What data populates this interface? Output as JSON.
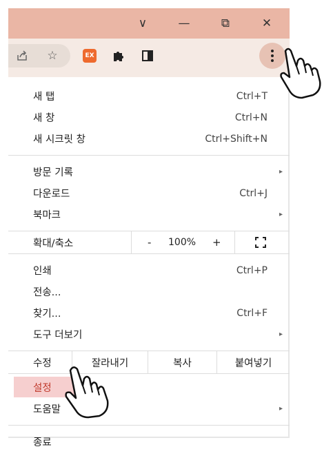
{
  "window": {
    "dropdown_glyph": "∨",
    "minimize_glyph": "—",
    "restore_glyph": "⧉",
    "close_glyph": "✕"
  },
  "toolbar": {
    "extension_badge": "EX",
    "icons": [
      "share-icon",
      "star-icon",
      "extension-ex-icon",
      "puzzle-icon",
      "side-panel-icon",
      "more-menu-icon"
    ]
  },
  "menu": {
    "group1": [
      {
        "label": "새 탭",
        "shortcut": "Ctrl+T"
      },
      {
        "label": "새 창",
        "shortcut": "Ctrl+N"
      },
      {
        "label": "새 시크릿 창",
        "shortcut": "Ctrl+Shift+N"
      }
    ],
    "group2": [
      {
        "label": "방문 기록",
        "shortcut": "",
        "submenu": true
      },
      {
        "label": "다운로드",
        "shortcut": "Ctrl+J",
        "submenu": false
      },
      {
        "label": "북마크",
        "shortcut": "",
        "submenu": true
      }
    ],
    "zoom": {
      "label": "확대/축소",
      "minus": "-",
      "value": "100%",
      "plus": "+"
    },
    "group3": [
      {
        "label": "인쇄",
        "shortcut": "Ctrl+P",
        "submenu": false
      },
      {
        "label": "전송...",
        "shortcut": "",
        "submenu": false
      },
      {
        "label": "찾기...",
        "shortcut": "Ctrl+F",
        "submenu": false
      },
      {
        "label": "도구 더보기",
        "shortcut": "",
        "submenu": true
      }
    ],
    "edit": {
      "label": "수정",
      "cut": "잘라내기",
      "copy": "복사",
      "paste": "붙여넣기"
    },
    "group4": [
      {
        "label": "설정",
        "submenu": false,
        "highlighted": true
      },
      {
        "label": "도움말",
        "submenu": true
      }
    ],
    "exit": {
      "label": "종료"
    },
    "arrow_glyph": "▸"
  },
  "colors": {
    "titlebar": "#eab6a5",
    "toolbar": "#f5eae4",
    "highlight": "#f6cfcf"
  }
}
